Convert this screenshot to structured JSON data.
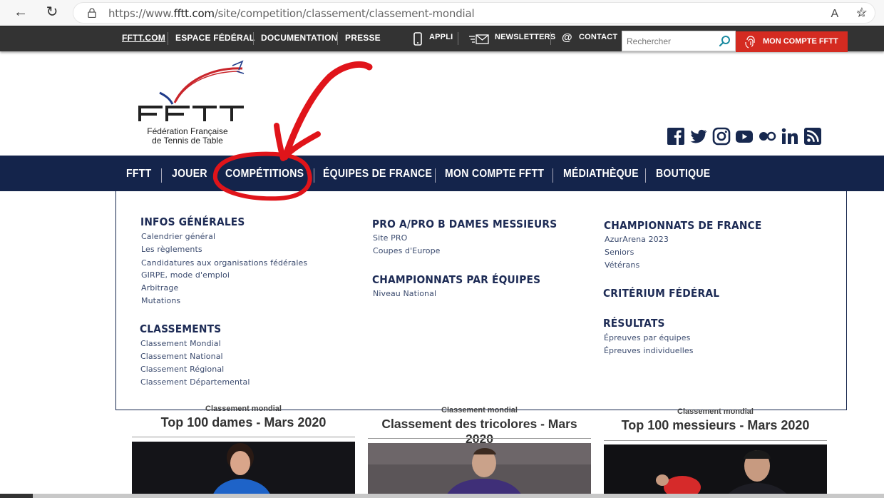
{
  "browser": {
    "url_prefix": "https://www.",
    "url_host": "fftt.com",
    "url_path": "/site/competition/classement/classement-mondial",
    "back_icon": "←",
    "reload_icon": "↻",
    "read_aloud_icon": "A",
    "favorite_add_icon": "☆",
    "favorites_icon": "☆"
  },
  "topbar": {
    "links": [
      "FFTT.COM",
      "ESPACE FÉDÉRAL",
      "DOCUMENTATION",
      "PRESSE"
    ],
    "appli": "APPLI",
    "newsletters": "NEWSLETTERS",
    "contact": "CONTACT",
    "search_placeholder": "Rechercher",
    "account": "MON COMPTE FFTT"
  },
  "logo": {
    "letters": "FFTT",
    "line1": "Fédération Française",
    "line2": "de Tennis de Table"
  },
  "social": [
    "facebook-icon",
    "twitter-icon",
    "instagram-icon",
    "youtube-icon",
    "flickr-icon",
    "linkedin-icon",
    "rss-icon"
  ],
  "mainnav": [
    "FFTT",
    "JOUER",
    "COMPÉTITIONS",
    "ÉQUIPES DE FRANCE",
    "MON COMPTE FFTT",
    "MÉDIATHÈQUE",
    "BOUTIQUE"
  ],
  "dropdown": {
    "col1": {
      "infos_title": "INFOS GÉNÉRALES",
      "infos": [
        "Calendrier général",
        "Les règlements",
        "Candidatures aux organisations fédérales",
        "GIRPE, mode d'emploi",
        "Arbitrage",
        "Mutations"
      ],
      "classements_title": "CLASSEMENTS",
      "classements": [
        "Classement Mondial",
        "Classement National",
        "Classement Régional",
        "Classement Départemental"
      ]
    },
    "col2": {
      "pro_title": "PRO A/PRO B DAMES MESSIEURS",
      "pro": [
        "Site PRO",
        "Coupes d'Europe"
      ],
      "equipes_title": "CHAMPIONNATS PAR ÉQUIPES",
      "equipes": [
        "Niveau National"
      ]
    },
    "col3": {
      "cdf_title": "CHAMPIONNATS DE FRANCE",
      "cdf": [
        "AzurArena 2023",
        "Seniors",
        "Vétérans"
      ],
      "criterium_title": "CRITÉRIUM FÉDÉRAL",
      "resultats_title": "RÉSULTATS",
      "resultats": [
        "Épreuves par équipes",
        "Épreuves individuelles"
      ]
    }
  },
  "cards": [
    {
      "caption": "Classement mondial",
      "title": "Top 100 dames - Mars 2020"
    },
    {
      "caption": "Classement mondial",
      "title": "Classement des tricolores - Mars 2020"
    },
    {
      "caption": "Classement mondial",
      "title": "Top 100 messieurs - Mars 2020"
    }
  ],
  "colors": {
    "navy": "#14244b",
    "topbar": "#333333",
    "account_red": "#d42b21",
    "annotation_red": "#e0141a"
  }
}
